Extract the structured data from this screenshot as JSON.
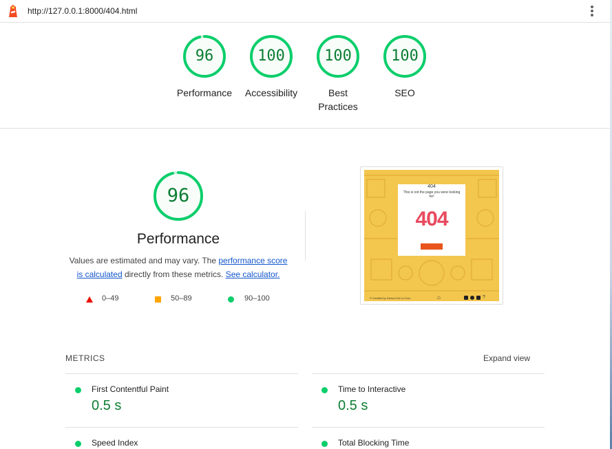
{
  "browser": {
    "url": "http://127.0.0.1:8000/404.html",
    "logo_icon": "lighthouse-icon",
    "menu_icon": "kebab-menu-icon"
  },
  "colors": {
    "pass": "#0cce6b",
    "pass_text": "#0c7d32",
    "average": "#ffa400",
    "fail": "#eb0f00",
    "link": "#1155cc"
  },
  "gauges": [
    {
      "score": 96,
      "label": "Performance"
    },
    {
      "score": 100,
      "label": "Accessibility"
    },
    {
      "score": 100,
      "label": "Best Practices"
    },
    {
      "score": 100,
      "label": "SEO"
    }
  ],
  "performance": {
    "score": 96,
    "title": "Performance",
    "desc_prefix": "Values are estimated and may vary. The",
    "link1": "performance score is calculated",
    "desc_middle": "directly from these metrics.",
    "link2": "See calculator."
  },
  "legend": {
    "fail": "0–49",
    "average": "50–89",
    "pass": "90–100"
  },
  "screenshot": {
    "heading": "404",
    "message": "This is not the page you were looking for!",
    "big_text": "404",
    "footer_credit": "© Created by Gerson De La Cruz"
  },
  "metrics": {
    "heading": "METRICS",
    "expand_label": "Expand view",
    "items": [
      {
        "name": "First Contentful Paint",
        "value": "0.5 s"
      },
      {
        "name": "Time to Interactive",
        "value": "0.5 s"
      },
      {
        "name": "Speed Index",
        "value": ""
      },
      {
        "name": "Total Blocking Time",
        "value": ""
      }
    ]
  }
}
